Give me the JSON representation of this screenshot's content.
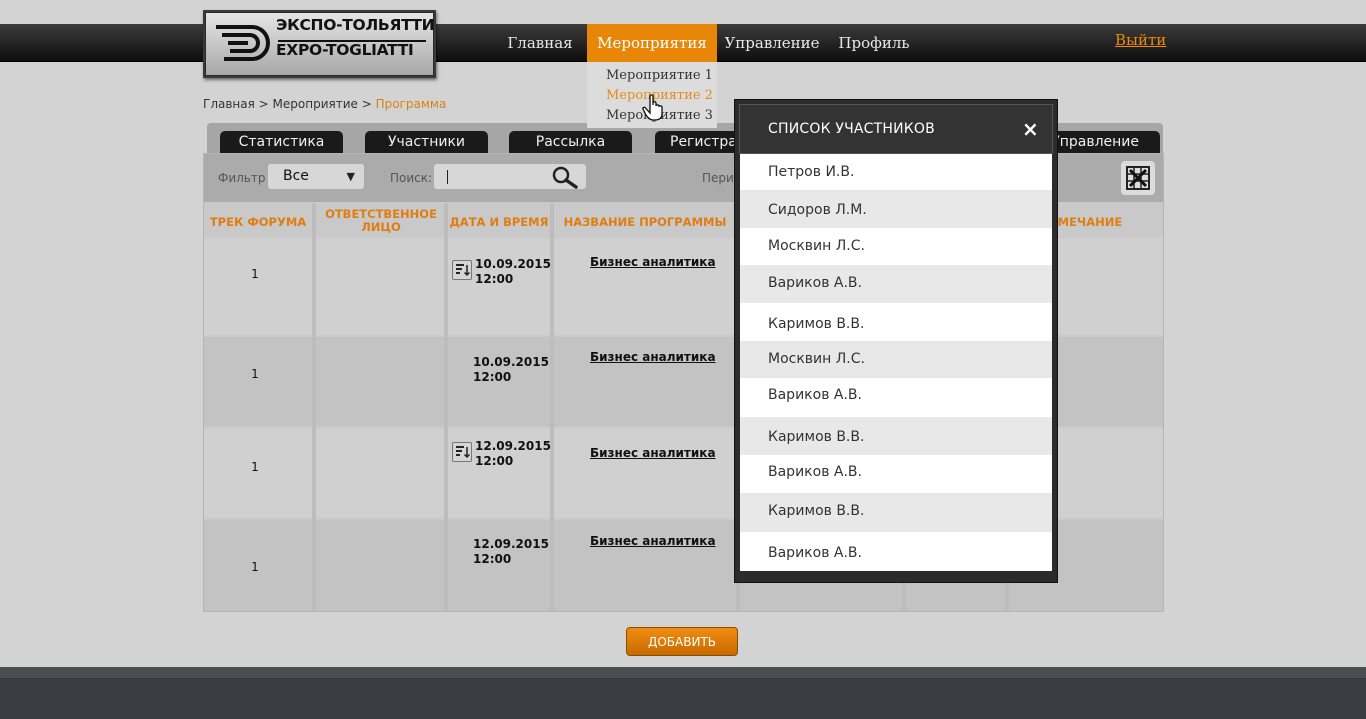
{
  "logo": {
    "ru": "ЭКСПО-ТОЛЬЯТТИ",
    "en": "EXPO-TOGLIATTI"
  },
  "nav": {
    "items": [
      {
        "label": "Главная"
      },
      {
        "label": "Мероприятия"
      },
      {
        "label": "Управление"
      },
      {
        "label": "Профиль"
      }
    ],
    "logout": "Выйти"
  },
  "dropdown": {
    "items": [
      "Мероприятие 1",
      "Мероприятие 2",
      "Мероприятие 3"
    ]
  },
  "breadcrumb": {
    "home": "Главная",
    "sep1": " > ",
    "event": "Мероприятие",
    "sep2": " > ",
    "current": "Программа"
  },
  "tabs": [
    "Статистика",
    "Участники",
    "Рассылка",
    "Регистра",
    "Управление"
  ],
  "filters": {
    "filter_label": "Фильтр",
    "filter_value": "Все",
    "search_label": "Поиск:",
    "period_label": "Пери"
  },
  "table": {
    "headers": [
      "ТРЕК ФОРУМА",
      "ОТВЕТСТВЕННОЕ ЛИЦО",
      "ДАТА И ВРЕМЯ",
      "НАЗВАНИЕ ПРОГРАММЫ",
      "ИМЕЧАНИЕ"
    ],
    "rows": [
      {
        "track": "1",
        "date": "10.09.2015",
        "time": "12:00",
        "program": "Бизнес аналитика"
      },
      {
        "track": "1",
        "date": "10.09.2015",
        "time": "12:00",
        "program": "Бизнес аналитика"
      },
      {
        "track": "1",
        "date": "12.09.2015",
        "time": "12:00",
        "program": "Бизнес аналитика"
      },
      {
        "track": "1",
        "date": "12.09.2015",
        "time": "12:00",
        "program": "Бизнес аналитика"
      }
    ]
  },
  "add_button": "ДОБАВИТЬ",
  "modal": {
    "title": "СПИСОК УЧАСТНИКОВ",
    "close": "×",
    "participants": [
      "Петров И.В.",
      "Сидоров Л.М.",
      "Москвин Л.С.",
      "Вариков А.В.",
      "Каримов В.В.",
      "Москвин Л.С.",
      "Вариков А.В.",
      "Каримов В.В.",
      "Вариков А.В.",
      "Каримов В.В.",
      "Вариков А.В."
    ]
  }
}
